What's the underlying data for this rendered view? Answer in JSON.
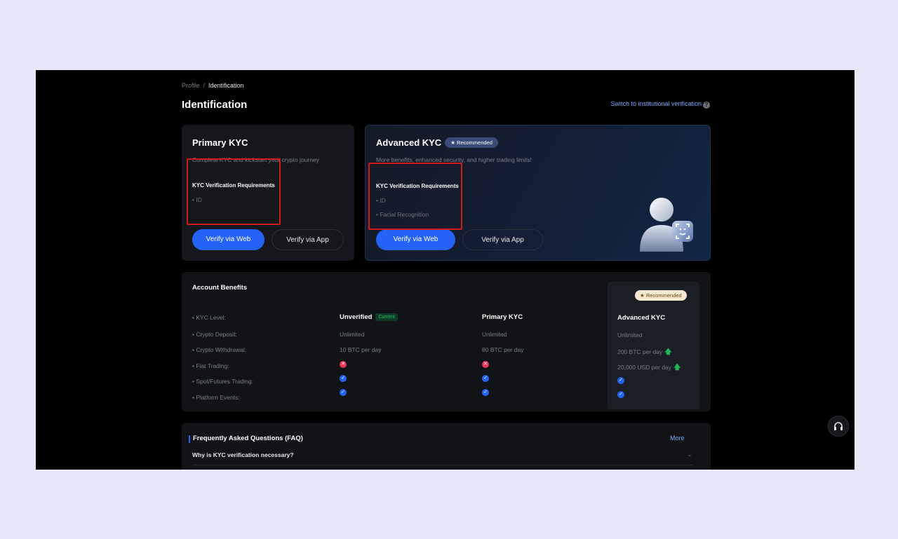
{
  "breadcrumb": {
    "parent": "Profile",
    "separator": "/",
    "current": "Identification"
  },
  "page_title": "Identification",
  "switch_link": "Switch to institutional verification",
  "primary_kyc": {
    "title": "Primary KYC",
    "description": "Complete KYC and kickstart your crypto journey",
    "requirements_title": "KYC Verification Requirements",
    "requirements": [
      "• ID"
    ],
    "verify_web": "Verify via Web",
    "verify_app": "Verify via App"
  },
  "advanced_kyc": {
    "title": "Advanced KYC",
    "badge": "Recommended",
    "description": "More benefits, enhanced security, and higher trading limits!",
    "requirements_title": "KYC Verification Requirements",
    "requirements": [
      "• ID",
      "• Facial Recognition"
    ],
    "verify_web": "Verify via Web",
    "verify_app": "Verify via App"
  },
  "benefits": {
    "title": "Account Benefits",
    "labels": [
      "• KYC Level:",
      "• Crypto Deposit:",
      "• Crypto Withdrawal:",
      "• Fiat Trading:",
      "• Spot/Futures Trading:",
      "• Platform Events:"
    ],
    "unverified": {
      "header": "Unverified",
      "current_badge": "Current",
      "deposit": "Unlimited",
      "withdrawal": "10 BTC per day",
      "fiat": "cross",
      "spot": "check",
      "events": "check"
    },
    "primary": {
      "header": "Primary KYC",
      "deposit": "Unlimited",
      "withdrawal": "80 BTC per day",
      "fiat": "cross",
      "spot": "check",
      "events": "check"
    },
    "advanced": {
      "badge": "Recommended",
      "header": "Advanced KYC",
      "deposit": "Unlimited",
      "withdrawal": "200 BTC per day",
      "fiat": "20,000 USD per day",
      "spot": "check",
      "events": "check"
    }
  },
  "faq": {
    "title": "Frequently Asked Questions (FAQ)",
    "more": "More",
    "questions": [
      "Why is KYC verification necessary?"
    ]
  },
  "icons": {
    "help": "question-circle-icon",
    "star": "star-icon",
    "check": "check-circle-icon",
    "cross": "x-circle-icon",
    "arrow_up": "arrow-up-icon",
    "chevron": "chevron-down-icon",
    "support": "headset-icon",
    "illustration": "face-id-user-icon"
  },
  "colors": {
    "accent": "#2463f5",
    "success": "#1fb35c",
    "error": "#e8355b",
    "link": "#78a9ff",
    "highlight_box": "#d11a1a"
  }
}
